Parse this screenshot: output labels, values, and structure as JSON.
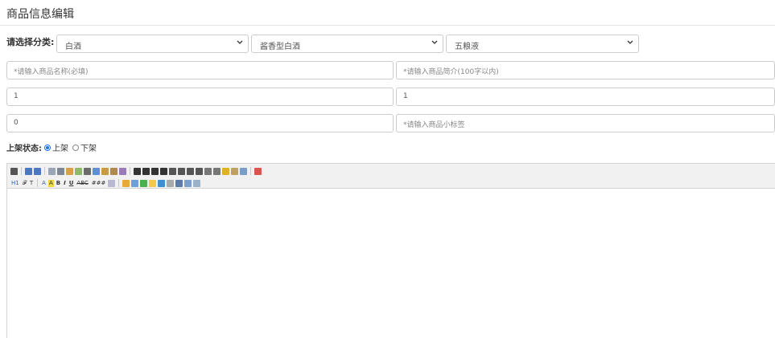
{
  "page": {
    "title": "商品信息编辑"
  },
  "category": {
    "label": "请选择分类:",
    "level1": "白酒",
    "level2": "酱香型白酒",
    "level3": "五粮液"
  },
  "form": {
    "name_placeholder": "*请输入商品名称(必填)",
    "intro_placeholder": "*请输入商品简介(100字以内)",
    "field_a": "1",
    "field_b": "1",
    "field_c": "0",
    "tag_placeholder": "*请输入商品小标签"
  },
  "status": {
    "label": "上架状态:",
    "on_label": "上架",
    "off_label": "下架",
    "selected": "上架"
  },
  "editor": {
    "heading_btn": "H1",
    "font_btn": "𝓕",
    "size_btn": "T",
    "color_btn": "A",
    "bg_btn": "A",
    "bold_btn": "B",
    "italic_btn": "I",
    "underline_btn": "U",
    "strike_btn": "ABC",
    "grid_btn": "###"
  },
  "colors": {
    "accent": "#1a73e8",
    "border": "#cccccc",
    "toolbar_bg": "#f1f1f1"
  }
}
